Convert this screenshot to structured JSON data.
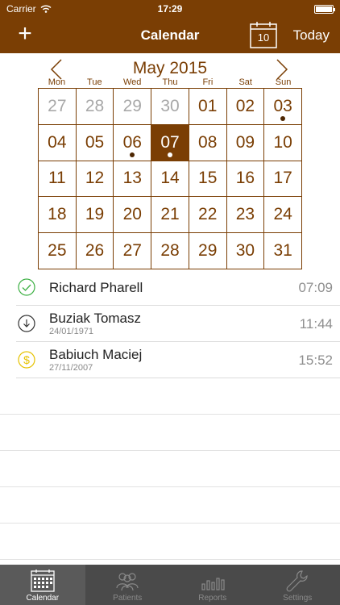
{
  "status_bar": {
    "carrier": "Carrier",
    "time": "17:29"
  },
  "nav": {
    "title": "Calendar",
    "add_label": "+",
    "today_icon_day": "10",
    "today_label": "Today"
  },
  "calendar": {
    "month_title": "May 2015",
    "weekdays": [
      "Mon",
      "Tue",
      "Wed",
      "Thu",
      "Fri",
      "Sat",
      "Sun"
    ],
    "days": [
      {
        "label": "27",
        "other": true,
        "dot": false,
        "selected": false
      },
      {
        "label": "28",
        "other": true,
        "dot": false,
        "selected": false
      },
      {
        "label": "29",
        "other": true,
        "dot": false,
        "selected": false
      },
      {
        "label": "30",
        "other": true,
        "dot": false,
        "selected": false
      },
      {
        "label": "01",
        "other": false,
        "dot": false,
        "selected": false
      },
      {
        "label": "02",
        "other": false,
        "dot": false,
        "selected": false
      },
      {
        "label": "03",
        "other": false,
        "dot": true,
        "selected": false
      },
      {
        "label": "04",
        "other": false,
        "dot": false,
        "selected": false
      },
      {
        "label": "05",
        "other": false,
        "dot": false,
        "selected": false
      },
      {
        "label": "06",
        "other": false,
        "dot": true,
        "selected": false
      },
      {
        "label": "07",
        "other": false,
        "dot": true,
        "selected": true
      },
      {
        "label": "08",
        "other": false,
        "dot": false,
        "selected": false
      },
      {
        "label": "09",
        "other": false,
        "dot": false,
        "selected": false
      },
      {
        "label": "10",
        "other": false,
        "dot": false,
        "selected": false
      },
      {
        "label": "11",
        "other": false,
        "dot": false,
        "selected": false
      },
      {
        "label": "12",
        "other": false,
        "dot": false,
        "selected": false
      },
      {
        "label": "13",
        "other": false,
        "dot": false,
        "selected": false
      },
      {
        "label": "14",
        "other": false,
        "dot": false,
        "selected": false
      },
      {
        "label": "15",
        "other": false,
        "dot": false,
        "selected": false
      },
      {
        "label": "16",
        "other": false,
        "dot": false,
        "selected": false
      },
      {
        "label": "17",
        "other": false,
        "dot": false,
        "selected": false
      },
      {
        "label": "18",
        "other": false,
        "dot": false,
        "selected": false
      },
      {
        "label": "19",
        "other": false,
        "dot": false,
        "selected": false
      },
      {
        "label": "20",
        "other": false,
        "dot": false,
        "selected": false
      },
      {
        "label": "21",
        "other": false,
        "dot": false,
        "selected": false
      },
      {
        "label": "22",
        "other": false,
        "dot": false,
        "selected": false
      },
      {
        "label": "23",
        "other": false,
        "dot": false,
        "selected": false
      },
      {
        "label": "24",
        "other": false,
        "dot": false,
        "selected": false
      },
      {
        "label": "25",
        "other": false,
        "dot": false,
        "selected": false
      },
      {
        "label": "26",
        "other": false,
        "dot": false,
        "selected": false
      },
      {
        "label": "27",
        "other": false,
        "dot": false,
        "selected": false
      },
      {
        "label": "28",
        "other": false,
        "dot": false,
        "selected": false
      },
      {
        "label": "29",
        "other": false,
        "dot": false,
        "selected": false
      },
      {
        "label": "30",
        "other": false,
        "dot": false,
        "selected": false
      },
      {
        "label": "31",
        "other": false,
        "dot": false,
        "selected": false
      }
    ]
  },
  "appointments": [
    {
      "name": "Richard Pharell",
      "date": "",
      "time": "07:09",
      "icon": "check-circle-icon"
    },
    {
      "name": "Buziak Tomasz",
      "date": "24/01/1971",
      "time": "11:44",
      "icon": "download-circle-icon"
    },
    {
      "name": "Babiuch Maciej",
      "date": "27/11/2007",
      "time": "15:52",
      "icon": "dollar-circle-icon"
    }
  ],
  "tabs": [
    {
      "label": "Calendar",
      "icon": "calendar-icon",
      "active": true
    },
    {
      "label": "Patients",
      "icon": "patients-icon",
      "active": false
    },
    {
      "label": "Reports",
      "icon": "reports-icon",
      "active": false
    },
    {
      "label": "Settings",
      "icon": "wrench-icon",
      "active": false
    }
  ],
  "colors": {
    "brand": "#7a3e04",
    "check": "#3cb043",
    "dollar": "#e6c200",
    "tab_bar": "#4a4a4a"
  }
}
